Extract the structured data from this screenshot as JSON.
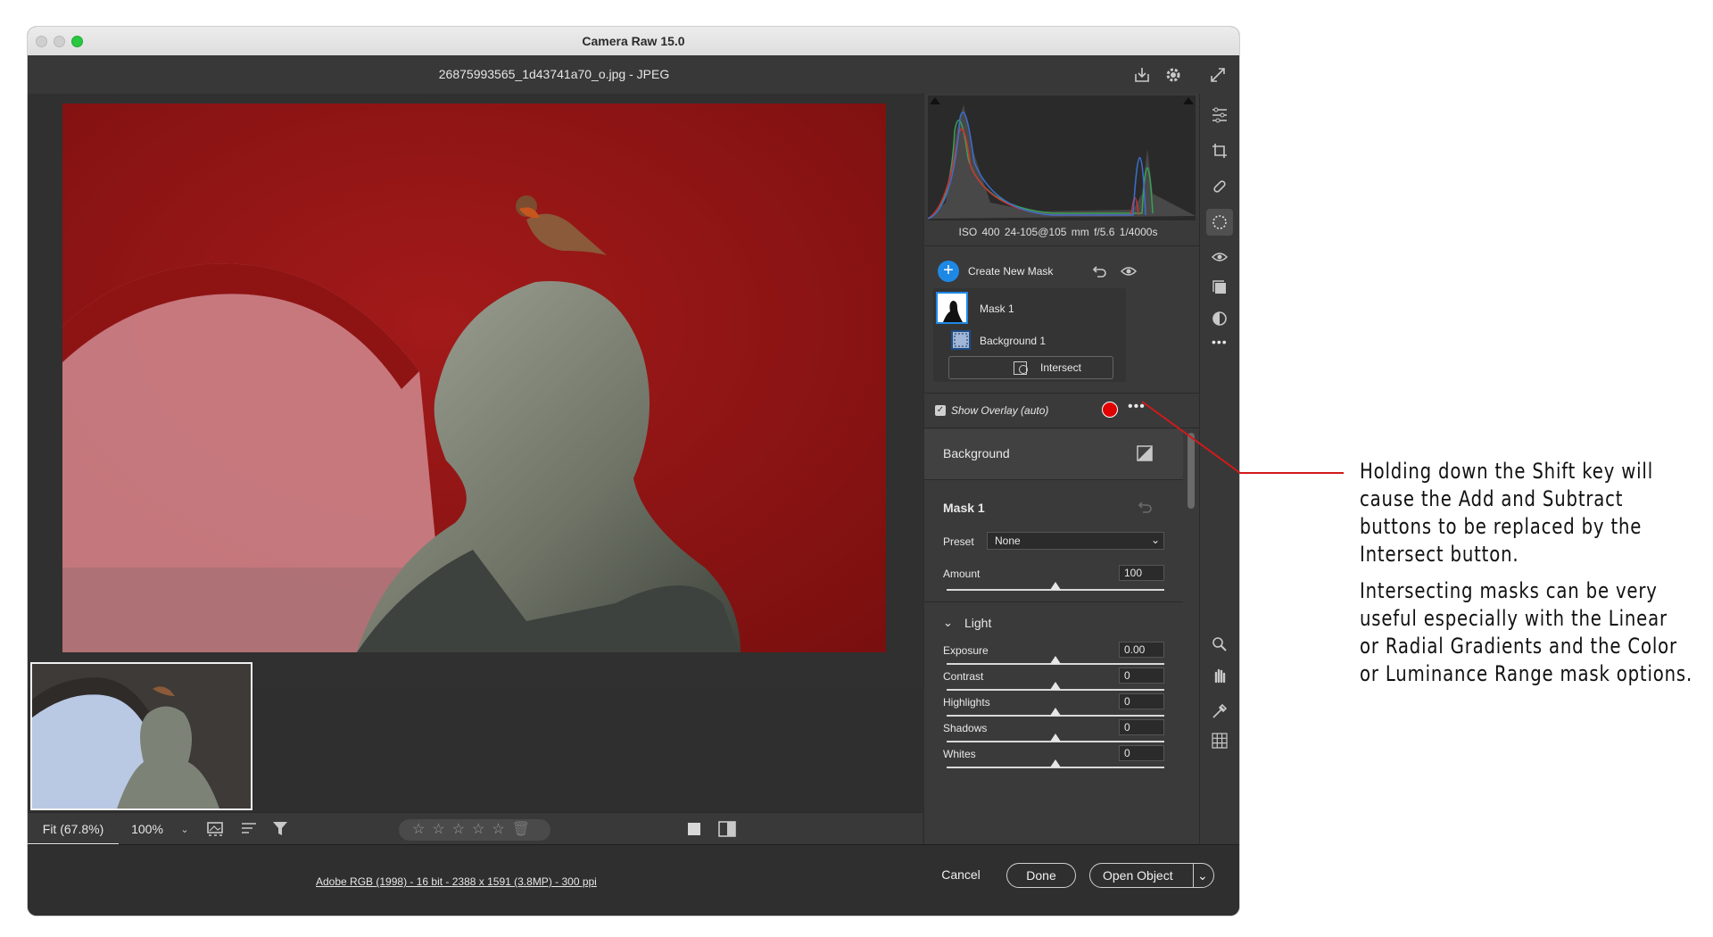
{
  "window": {
    "title": "Camera Raw 15.0"
  },
  "file": {
    "name": "26875993565_1d43741a70_o.jpg  -  JPEG"
  },
  "histogram": {
    "exif": "ISO 400   24-105@105 mm   f/5.6   1/4000s"
  },
  "masks": {
    "create_label": "Create New Mask",
    "items": [
      {
        "label": "Mask 1"
      },
      {
        "label": "Background 1"
      }
    ],
    "intersect_label": "Intersect",
    "overlay_label": "Show Overlay (auto)",
    "overlay_color": "#e00000"
  },
  "panel": {
    "background_title": "Background",
    "mask_title": "Mask 1",
    "preset_label": "Preset",
    "preset_value": "None",
    "amount_label": "Amount",
    "amount_value": "100",
    "amount_level": 0.5,
    "light_title": "Light",
    "sliders": [
      {
        "label": "Exposure",
        "value": "0.00",
        "level": 0.5
      },
      {
        "label": "Contrast",
        "value": "0",
        "level": 0.5
      },
      {
        "label": "Highlights",
        "value": "0",
        "level": 0.5
      },
      {
        "label": "Shadows",
        "value": "0",
        "level": 0.5
      },
      {
        "label": "Whites",
        "value": "0",
        "level": 0.5
      }
    ]
  },
  "view": {
    "fit": "Fit (67.8%)",
    "zoom": "100%"
  },
  "footer": {
    "profile": "Adobe RGB (1998) - 16 bit - 2388 x 1591 (3.8MP) - 300 ppi",
    "cancel": "Cancel",
    "done": "Done",
    "open": "Open Object"
  },
  "annotation": {
    "lines": [
      "Holding down the Shift key will",
      "cause the Add and Subtract",
      "buttons to be replaced by the",
      "Intersect button.",
      "Intersecting masks can be very",
      "useful especially with the Linear",
      "or Radial Gradients and the Color",
      "or Luminance Range mask options."
    ],
    "line_color": "#d11a1a"
  },
  "colors": {
    "accent": "#1e88e5",
    "mask_overlay": "#9b1010"
  }
}
